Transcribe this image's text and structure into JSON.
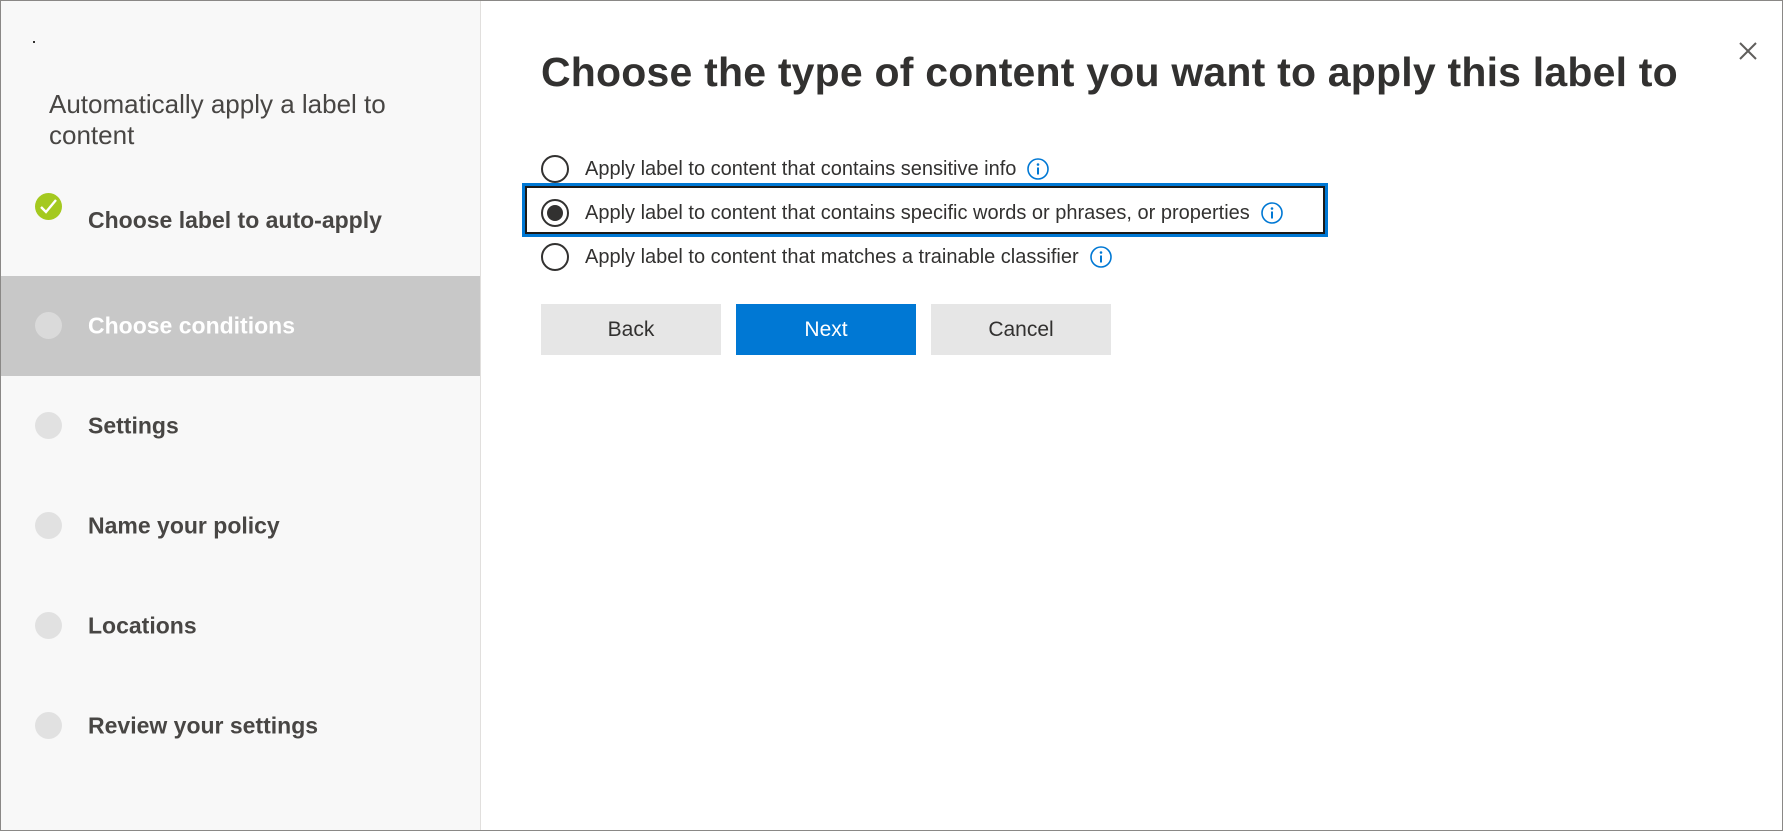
{
  "sidebar": {
    "title": "Automatically apply a label to content",
    "steps": [
      {
        "label": "Choose label to auto-apply",
        "status": "complete"
      },
      {
        "label": "Choose conditions",
        "status": "current"
      },
      {
        "label": "Settings",
        "status": "pending"
      },
      {
        "label": "Name your policy",
        "status": "pending"
      },
      {
        "label": "Locations",
        "status": "pending"
      },
      {
        "label": "Review your settings",
        "status": "pending"
      }
    ]
  },
  "main": {
    "title": "Choose the type of content you want to apply this label to",
    "options": [
      {
        "label": "Apply label to content that contains sensitive info",
        "selected": false
      },
      {
        "label": "Apply label to content that contains specific words or phrases, or properties",
        "selected": true
      },
      {
        "label": "Apply label to content that matches a trainable classifier",
        "selected": false
      }
    ],
    "buttons": {
      "back": "Back",
      "next": "Next",
      "cancel": "Cancel"
    }
  },
  "icons": {
    "close": "close-icon",
    "info": "info-icon",
    "check": "checkmark-icon"
  },
  "colors": {
    "accent": "#0078d4",
    "complete": "#a4c91f",
    "current_step_bg": "#c8c8c8"
  }
}
